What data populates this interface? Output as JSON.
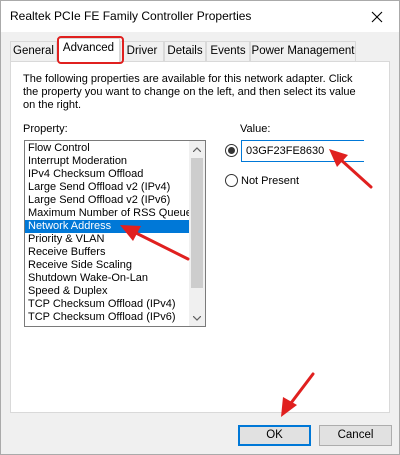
{
  "window": {
    "title": "Realtek PCIe FE Family Controller Properties"
  },
  "tabs": [
    {
      "label": "General"
    },
    {
      "label": "Advanced"
    },
    {
      "label": "Driver"
    },
    {
      "label": "Details"
    },
    {
      "label": "Events"
    },
    {
      "label": "Power Management"
    }
  ],
  "active_tab": "Advanced",
  "panel": {
    "description": "The following properties are available for this network adapter. Click the property you want to change on the left, and then select its value on the right.",
    "property_label": "Property:",
    "value_label": "Value:",
    "properties": [
      {
        "label": "Flow Control"
      },
      {
        "label": "Interrupt Moderation"
      },
      {
        "label": "IPv4 Checksum Offload"
      },
      {
        "label": "Large Send Offload v2 (IPv4)"
      },
      {
        "label": "Large Send Offload v2 (IPv6)"
      },
      {
        "label": "Maximum Number of RSS Queues"
      },
      {
        "label": "Network Address"
      },
      {
        "label": "Priority & VLAN"
      },
      {
        "label": "Receive Buffers"
      },
      {
        "label": "Receive Side Scaling"
      },
      {
        "label": "Shutdown Wake-On-Lan"
      },
      {
        "label": "Speed & Duplex"
      },
      {
        "label": "TCP Checksum Offload (IPv4)"
      },
      {
        "label": "TCP Checksum Offload (IPv6)"
      }
    ],
    "selected_property": "Network Address",
    "value_input": "03GF23FE8630",
    "not_present_label": "Not Present"
  },
  "buttons": {
    "ok": "OK",
    "cancel": "Cancel"
  },
  "colors": {
    "selection": "#0078d7",
    "annotation": "#e0201f"
  }
}
